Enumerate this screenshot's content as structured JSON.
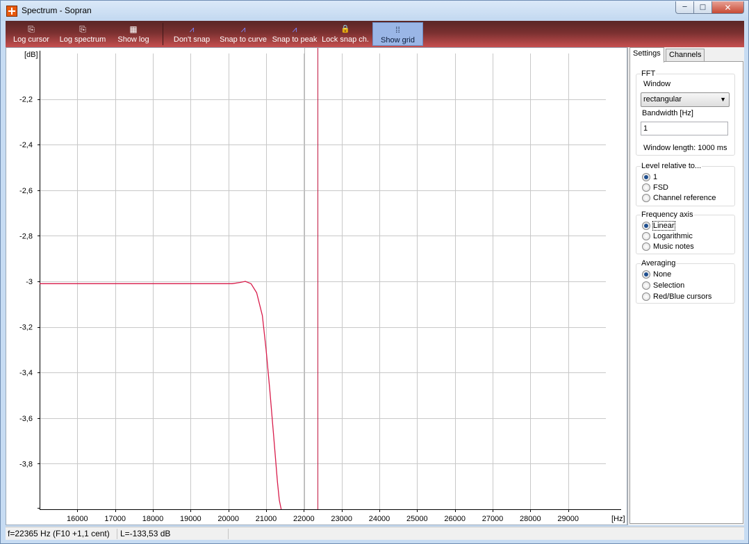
{
  "window": {
    "title": "Spectrum - Sopran",
    "controls": {
      "minimize": "─",
      "maximize": "□",
      "close": "✕"
    }
  },
  "toolbar": {
    "buttons": [
      {
        "label": "Log cursor",
        "icon": "log-cursor-icon",
        "glyph": "⎘"
      },
      {
        "label": "Log spectrum",
        "icon": "log-spectrum-icon",
        "glyph": "⎘"
      },
      {
        "label": "Show log",
        "icon": "show-log-icon",
        "glyph": "▦"
      },
      {
        "label": "Don't snap",
        "icon": "dont-snap-icon",
        "glyph": "⩘"
      },
      {
        "label": "Snap to curve",
        "icon": "snap-to-curve-icon",
        "glyph": "⩘"
      },
      {
        "label": "Snap to peak",
        "icon": "snap-to-peak-icon",
        "glyph": "⩘"
      },
      {
        "label": "Lock snap ch.",
        "icon": "lock-icon",
        "glyph": "🔒"
      },
      {
        "label": "Show grid",
        "icon": "grid-icon",
        "glyph": "⁞⁞",
        "active": true
      }
    ],
    "bg_color": "#7a3030",
    "active_color": "#9ab6e6"
  },
  "chart_data": {
    "type": "line",
    "ylabel": "[dB]",
    "xlabel": "[Hz]",
    "xlim": [
      15000,
      30000
    ],
    "ylim": [
      -4.0,
      -2.0
    ],
    "x_ticks": [
      16000,
      17000,
      18000,
      19000,
      20000,
      21000,
      22000,
      23000,
      24000,
      25000,
      26000,
      27000,
      28000,
      29000
    ],
    "y_ticks": [
      -2.2,
      -2.4,
      -2.6,
      -2.8,
      -3.0,
      -3.2,
      -3.4,
      -3.6,
      -3.8
    ],
    "y_tick_labels": [
      "-2,2",
      "-2,4",
      "-2,6",
      "-2,8",
      "-3",
      "-3,2",
      "-3,4",
      "-3,6",
      "-3,8"
    ],
    "grid": true,
    "line_color": "#d81b4a",
    "series": [
      {
        "x": [
          15000,
          16000,
          17000,
          18000,
          19000,
          19600,
          19900,
          20100,
          20300,
          20450,
          20600,
          20750,
          20900,
          21000,
          21100,
          21200,
          21300,
          21350,
          21400
        ],
        "y": [
          -3.01,
          -3.01,
          -3.01,
          -3.01,
          -3.01,
          -3.01,
          -3.01,
          -3.01,
          -3.005,
          -3.0,
          -3.01,
          -3.05,
          -3.15,
          -3.3,
          -3.48,
          -3.68,
          -3.88,
          -3.96,
          -4.0
        ]
      }
    ],
    "cursor_x": 22365,
    "grey_cursor_x": 22020,
    "cursor_color": "#c0143c"
  },
  "panel": {
    "tabs": [
      "Settings",
      "Channels"
    ],
    "fft": {
      "title": "FFT",
      "window_label": "Window",
      "window_value": "rectangular",
      "bandwidth_label": "Bandwidth [Hz]",
      "bandwidth_value": "1",
      "window_length": "Window length: 1000 ms"
    },
    "level": {
      "title": "Level relative to...",
      "options": [
        "1",
        "FSD",
        "Channel reference"
      ],
      "selected": 0
    },
    "freq_axis": {
      "title": "Frequency axis",
      "options": [
        "Linear",
        "Logarithmic",
        "Music notes"
      ],
      "selected": 0
    },
    "averaging": {
      "title": "Averaging",
      "options": [
        "None",
        "Selection",
        "Red/Blue cursors"
      ],
      "selected": 0
    }
  },
  "status": {
    "frequency": "f=22365 Hz (F10 +1,1 cent)",
    "level": "L=-133,53 dB"
  }
}
